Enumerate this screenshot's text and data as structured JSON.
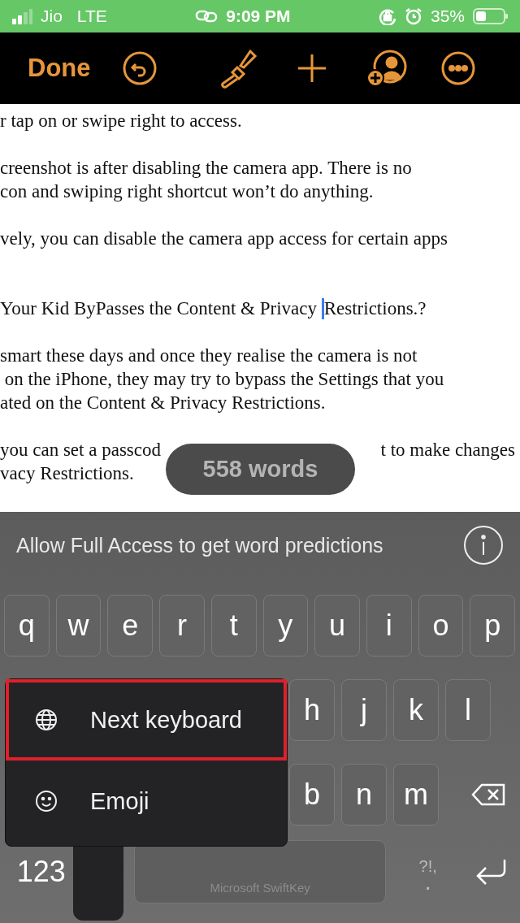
{
  "status_bar": {
    "carrier": "Jio",
    "network": "LTE",
    "time": "9:09 PM",
    "battery": "35%"
  },
  "toolbar": {
    "done": "Done"
  },
  "document": {
    "paragraphs": [
      {
        "lines": [
          "r tap on or swipe right to access."
        ]
      },
      {
        "lines": [
          "creenshot is after disabling the camera app. There is no",
          "con and swiping right shortcut won’t do anything."
        ]
      },
      {
        "lines": [
          "vely, you can disable the camera app access for certain apps"
        ]
      },
      {
        "kind": "heading",
        "lines": [
          "Your Kid ByPasses the Content & Privacy ",
          "Restrictions.?"
        ]
      },
      {
        "lines": [
          "smart these days and once they realise the camera is not",
          " on the iPhone, they may try to bypass the Settings that you",
          "ated on the Content & Privacy Restrictions."
        ]
      },
      {
        "kind": "covered",
        "lines": [
          "you can set a passcod",
          "t to make changes",
          "vacy Restrictions."
        ]
      }
    ],
    "word_count": "558 words"
  },
  "keyboard": {
    "prediction_bar": "Allow Full Access to get word predictions",
    "rows": [
      [
        "q",
        "w",
        "e",
        "r",
        "t",
        "y",
        "u",
        "i",
        "o",
        "p"
      ],
      [
        "h",
        "j",
        "k",
        "l"
      ],
      [
        "b",
        "n",
        "m"
      ]
    ],
    "numbers_key": "123",
    "space_label": "Microsoft SwiftKey",
    "punctuation_top": "?!,",
    "punctuation_bottom": ".",
    "popup": [
      {
        "kind": "globe",
        "label": "Next keyboard",
        "highlighted": true
      },
      {
        "kind": "emoji",
        "label": "Emoji",
        "highlighted": false
      }
    ]
  }
}
